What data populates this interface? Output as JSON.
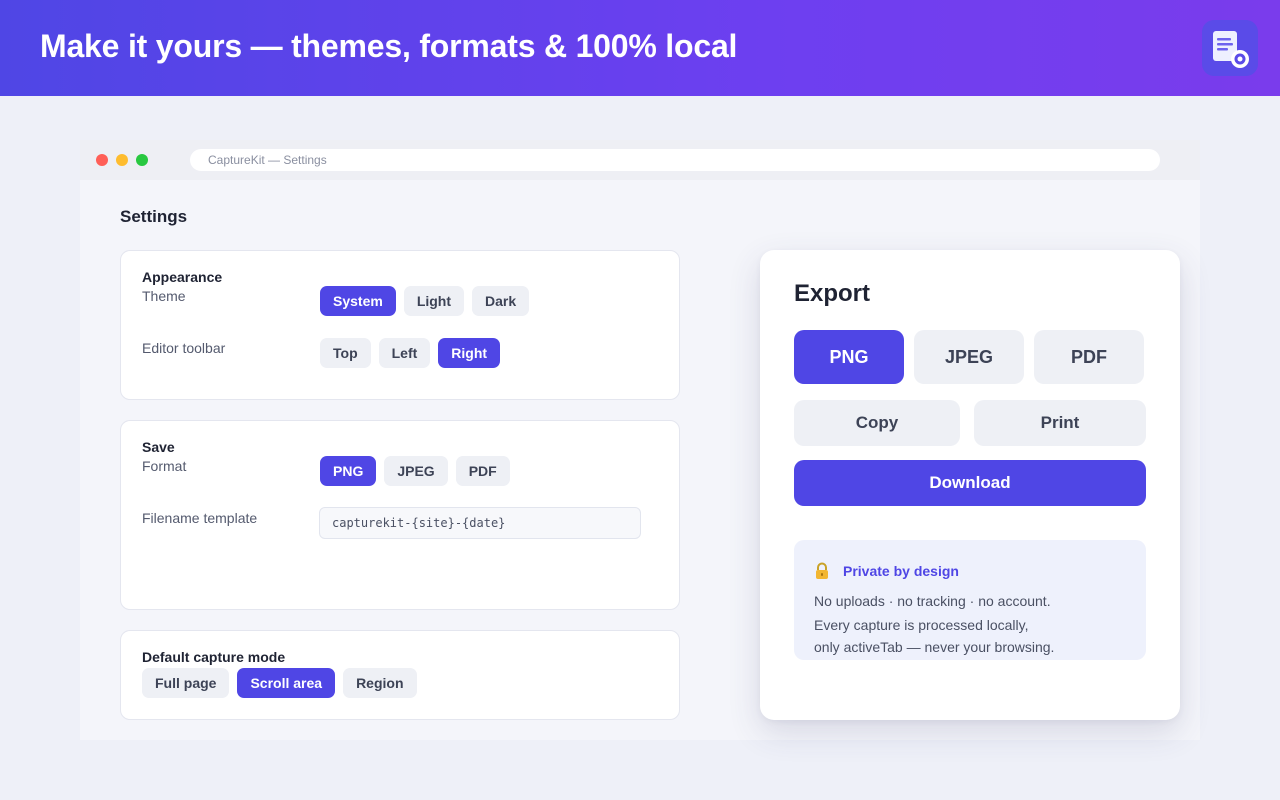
{
  "banner": {
    "title": "Make it yours — themes, formats & 100% local",
    "logo_icon": "document-search-icon"
  },
  "window": {
    "address": "CaptureKit — Settings"
  },
  "settings": {
    "heading": "Settings",
    "appearance": {
      "title": "Appearance",
      "theme_label": "Theme",
      "theme_options": [
        "System",
        "Light",
        "Dark"
      ],
      "theme_selected": "System",
      "toolbar_label": "Editor toolbar",
      "toolbar_options": [
        "Top",
        "Left",
        "Right"
      ],
      "toolbar_selected": "Right"
    },
    "save": {
      "title": "Save",
      "format_label": "Format",
      "format_options": [
        "PNG",
        "JPEG",
        "PDF"
      ],
      "format_selected": "PNG",
      "filename_label": "Filename template",
      "filename_value": "capturekit-{site}-{date}"
    },
    "capture_mode": {
      "title": "Default capture mode",
      "options": [
        "Full page",
        "Scroll area",
        "Region"
      ],
      "selected": "Scroll area"
    }
  },
  "export": {
    "title": "Export",
    "formats": [
      "PNG",
      "JPEG",
      "PDF"
    ],
    "selected_format": "PNG",
    "copy_label": "Copy",
    "print_label": "Print",
    "download_label": "Download",
    "privacy": {
      "icon": "lock-icon",
      "title": "Private by design",
      "line1": "No uploads · no tracking · no account.",
      "line2": "Every capture is processed locally,",
      "line3": "only activeTab — never your browsing."
    }
  },
  "colors": {
    "accent": "#4f46e5",
    "banner_end": "#7a3cec",
    "background": "#eef0f8"
  }
}
